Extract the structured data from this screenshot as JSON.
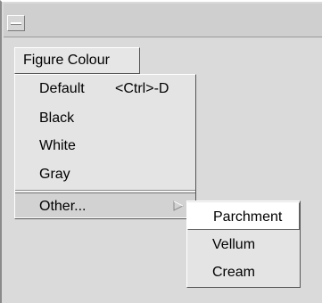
{
  "menubar": {
    "figure_colour_label": "Figure Colour"
  },
  "menu": {
    "items": [
      {
        "label": "Default",
        "accelerator": "<Ctrl>-D"
      },
      {
        "label": "Black"
      },
      {
        "label": "White"
      },
      {
        "label": "Gray"
      },
      {
        "label": "Other...",
        "has_submenu": true
      }
    ]
  },
  "submenu": {
    "items": [
      {
        "label": "Parchment",
        "active": true
      },
      {
        "label": "Vellum"
      },
      {
        "label": "Cream"
      }
    ]
  },
  "icons": {
    "window_menu": "window-menu-icon",
    "submenu_arrow": "submenu-arrow-icon"
  },
  "colors": {
    "background": "#dadada",
    "menu": "#e4e4e4"
  }
}
